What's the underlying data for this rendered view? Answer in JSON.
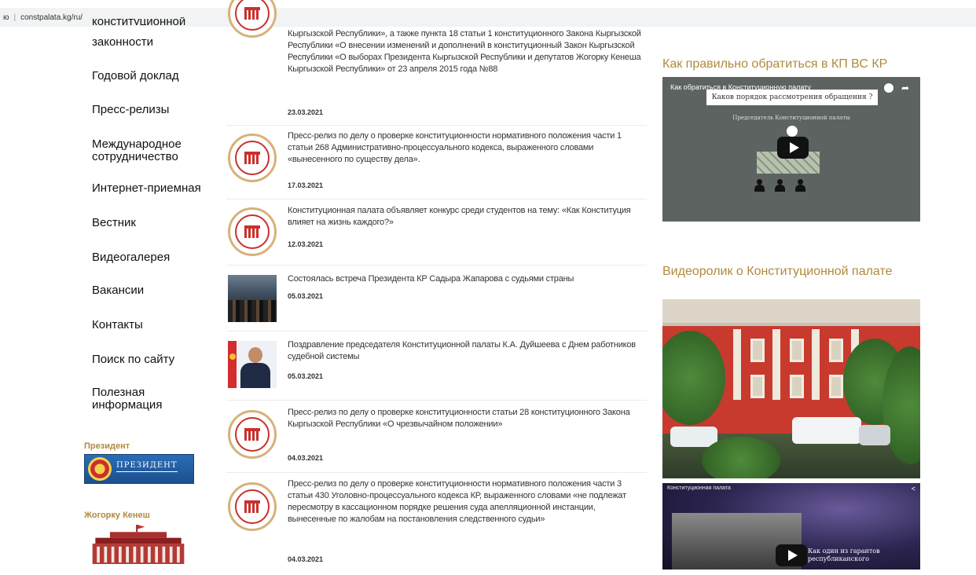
{
  "browser": {
    "url_prefix": "ю",
    "url": "constpalata.kg/ru/"
  },
  "sidebar": {
    "partial_top_line": "конституционной",
    "items": [
      {
        "label": "законности"
      },
      {
        "label": "Годовой доклад"
      },
      {
        "label": "Пресс-релизы"
      },
      {
        "label": "Международное\nсотрудничество"
      },
      {
        "label": "Интернет-приемная"
      },
      {
        "label": "Вестник"
      },
      {
        "label": "Видеогалерея"
      },
      {
        "label": "Вакансии"
      },
      {
        "label": "Контакты"
      },
      {
        "label": "Поиск по сайту"
      },
      {
        "label": "Полезная\nинформация"
      }
    ],
    "president_heading": "Президент",
    "president_banner": "ПРЕЗИДЕНТ",
    "kenesh_heading": "Жогорку Кенеш"
  },
  "news": [
    {
      "text": "Кыргызской Республики», а также пункта 18 статьи 1 конституционного Закона Кыргызской Республики «О внесении изменений и дополнений в конституционный Закон Кыргызской Республики «О выборах Президента Кыргызской Республики и депутатов Жогорку Кенеша Кыргызской Республики» от 23 апреля 2015 года №88",
      "date": "23.03.2021",
      "thumb": "seal"
    },
    {
      "text": "Пресс-релиз по делу о проверке конституционности нормативного положения части 1 статьи 268 Административно-процессуального кодекса, выраженного словами «вынесенного по существу дела».",
      "date": "17.03.2021",
      "thumb": "seal"
    },
    {
      "text": "Конституционная палата объявляет конкурс среди студентов на тему: «Как Конституция влияет на жизнь каждого?»",
      "date": "12.03.2021",
      "thumb": "seal"
    },
    {
      "text": "Состоялась встреча Президента КР Садыра Жапарова с судьями страны",
      "date": "05.03.2021",
      "thumb": "crowd-photo"
    },
    {
      "text": "Поздравление председателя Конституционной палаты К.А. Дуйшеева с Днем работников судебной системы",
      "date": "05.03.2021",
      "thumb": "person-photo"
    },
    {
      "text": "Пресс-релиз по делу о проверке конституционности статьи 28 конституционного Закона Кыргызской Республики «О чрезвычайном положении»",
      "date": "04.03.2021",
      "thumb": "seal"
    },
    {
      "text": "Пресс-релиз по делу о проверке конституционности нормативного положения части 3 статьи 430 Уголовно-процессуального кодекса КР, выраженного словами «не подлежат пересмотру в кассационном порядке решения суда апелляционной инстанции, вынесенные по жалобам на постановления следственного судьи»",
      "date": "04.03.2021",
      "thumb": "seal"
    }
  ],
  "right": {
    "title1": "Как правильно обратиться в КП ВС КР",
    "video1_title": "Как обратиться в Конституционную палату",
    "video1_board": "Каков порядок рассмотрения обращения ?",
    "video1_sub": "Председатель Конституционной палаты",
    "title2": "Видеоролик о Конституционной палате",
    "video3_title": "Конституционная палата",
    "video3_text": "Как один из гарантов\nреспубликанского"
  }
}
